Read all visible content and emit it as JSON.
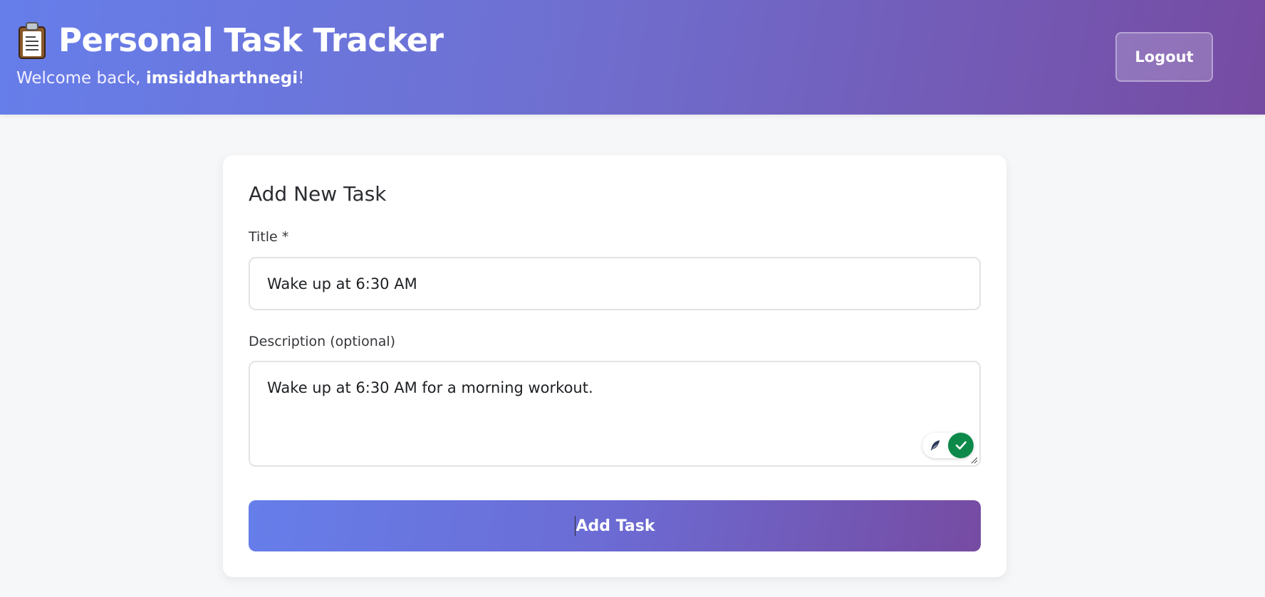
{
  "header": {
    "app_title": "Personal Task Tracker",
    "welcome_prefix": "Welcome back, ",
    "username": "imsiddharthnegi",
    "welcome_suffix": "!",
    "logout_label": "Logout",
    "icon": "clipboard-icon"
  },
  "form": {
    "heading": "Add New Task",
    "title_label": "Title *",
    "title_value": "Wake up at 6:30 AM",
    "description_label": "Description (optional)",
    "description_value": "Wake up at 6:30 AM for a morning workout.",
    "submit_label": "Add Task"
  },
  "colors": {
    "gradient_start": "#667eea",
    "gradient_end": "#764ba2",
    "grammar_check": "#0d8a4a"
  }
}
